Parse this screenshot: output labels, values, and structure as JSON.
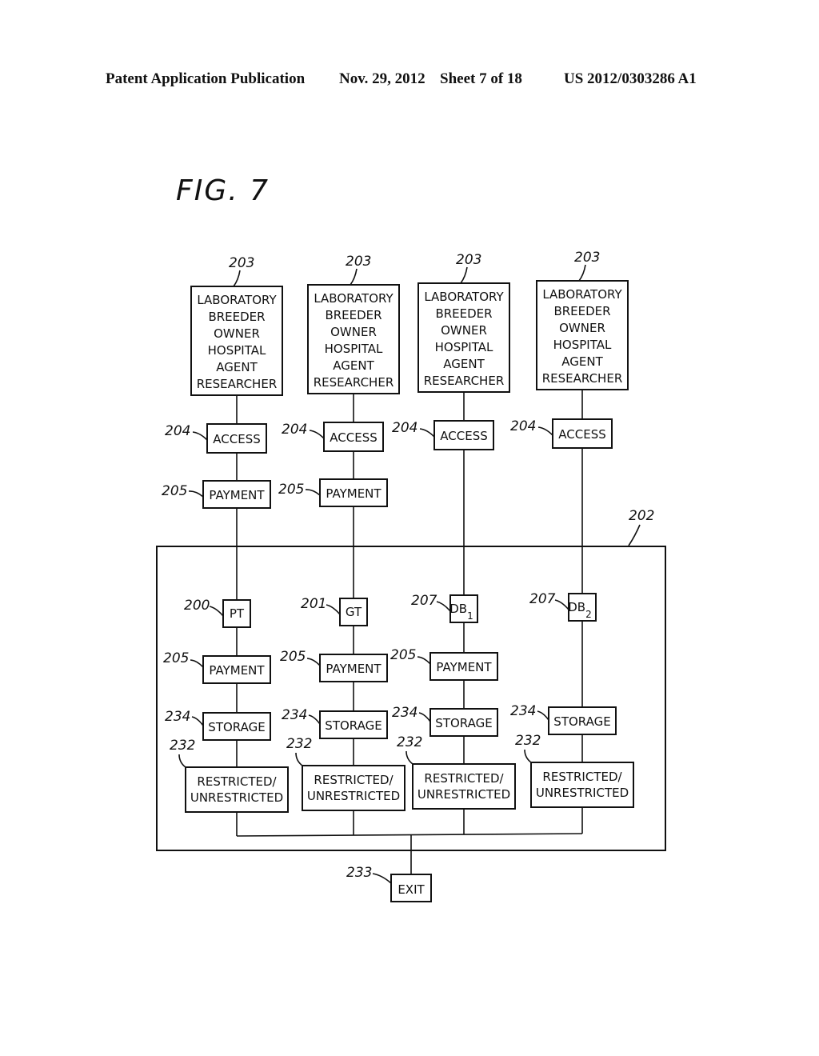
{
  "header": {
    "left": "Patent Application Publication",
    "date": "Nov. 29, 2012",
    "sheet": "Sheet 7 of 18",
    "number": "US 2012/0303286 A1"
  },
  "figure_label": "FIG. 7",
  "container": {
    "ref": "202"
  },
  "columns": [
    {
      "entity": {
        "ref": "203",
        "lines": [
          "LABORATORY",
          "BREEDER",
          "OWNER",
          "HOSPITAL",
          "AGENT",
          "RESEARCHER"
        ]
      },
      "access": {
        "ref": "204",
        "label": "ACCESS"
      },
      "payment_in": {
        "ref": "205",
        "label": "PAYMENT"
      },
      "node": {
        "ref": "200",
        "label": "PT",
        "sub": ""
      },
      "payment": {
        "ref": "205",
        "label": "PAYMENT"
      },
      "storage": {
        "ref": "234",
        "label": "STORAGE"
      },
      "restricted": {
        "ref": "232",
        "lines": [
          "RESTRICTED/",
          "UNRESTRICTED"
        ]
      }
    },
    {
      "entity": {
        "ref": "203",
        "lines": [
          "LABORATORY",
          "BREEDER",
          "OWNER",
          "HOSPITAL",
          "AGENT",
          "RESEARCHER"
        ]
      },
      "access": {
        "ref": "204",
        "label": "ACCESS"
      },
      "payment_in": {
        "ref": "205",
        "label": "PAYMENT"
      },
      "node": {
        "ref": "201",
        "label": "GT",
        "sub": ""
      },
      "payment": {
        "ref": "205",
        "label": "PAYMENT"
      },
      "storage": {
        "ref": "234",
        "label": "STORAGE"
      },
      "restricted": {
        "ref": "232",
        "lines": [
          "RESTRICTED/",
          "UNRESTRICTED"
        ]
      }
    },
    {
      "entity": {
        "ref": "203",
        "lines": [
          "LABORATORY",
          "BREEDER",
          "OWNER",
          "HOSPITAL",
          "AGENT",
          "RESEARCHER"
        ]
      },
      "access": {
        "ref": "204",
        "label": "ACCESS"
      },
      "node": {
        "ref": "207",
        "label": "DB",
        "sub": "1"
      },
      "payment": {
        "ref": "205",
        "label": "PAYMENT"
      },
      "storage": {
        "ref": "234",
        "label": "STORAGE"
      },
      "restricted": {
        "ref": "232",
        "lines": [
          "RESTRICTED/",
          "UNRESTRICTED"
        ]
      }
    },
    {
      "entity": {
        "ref": "203",
        "lines": [
          "LABORATORY",
          "BREEDER",
          "OWNER",
          "HOSPITAL",
          "AGENT",
          "RESEARCHER"
        ]
      },
      "access": {
        "ref": "204",
        "label": "ACCESS"
      },
      "node": {
        "ref": "207",
        "label": "DB",
        "sub": "2"
      },
      "storage": {
        "ref": "234",
        "label": "STORAGE"
      },
      "restricted": {
        "ref": "232",
        "lines": [
          "RESTRICTED/",
          "UNRESTRICTED"
        ]
      }
    }
  ],
  "exit": {
    "ref": "233",
    "label": "EXIT"
  }
}
